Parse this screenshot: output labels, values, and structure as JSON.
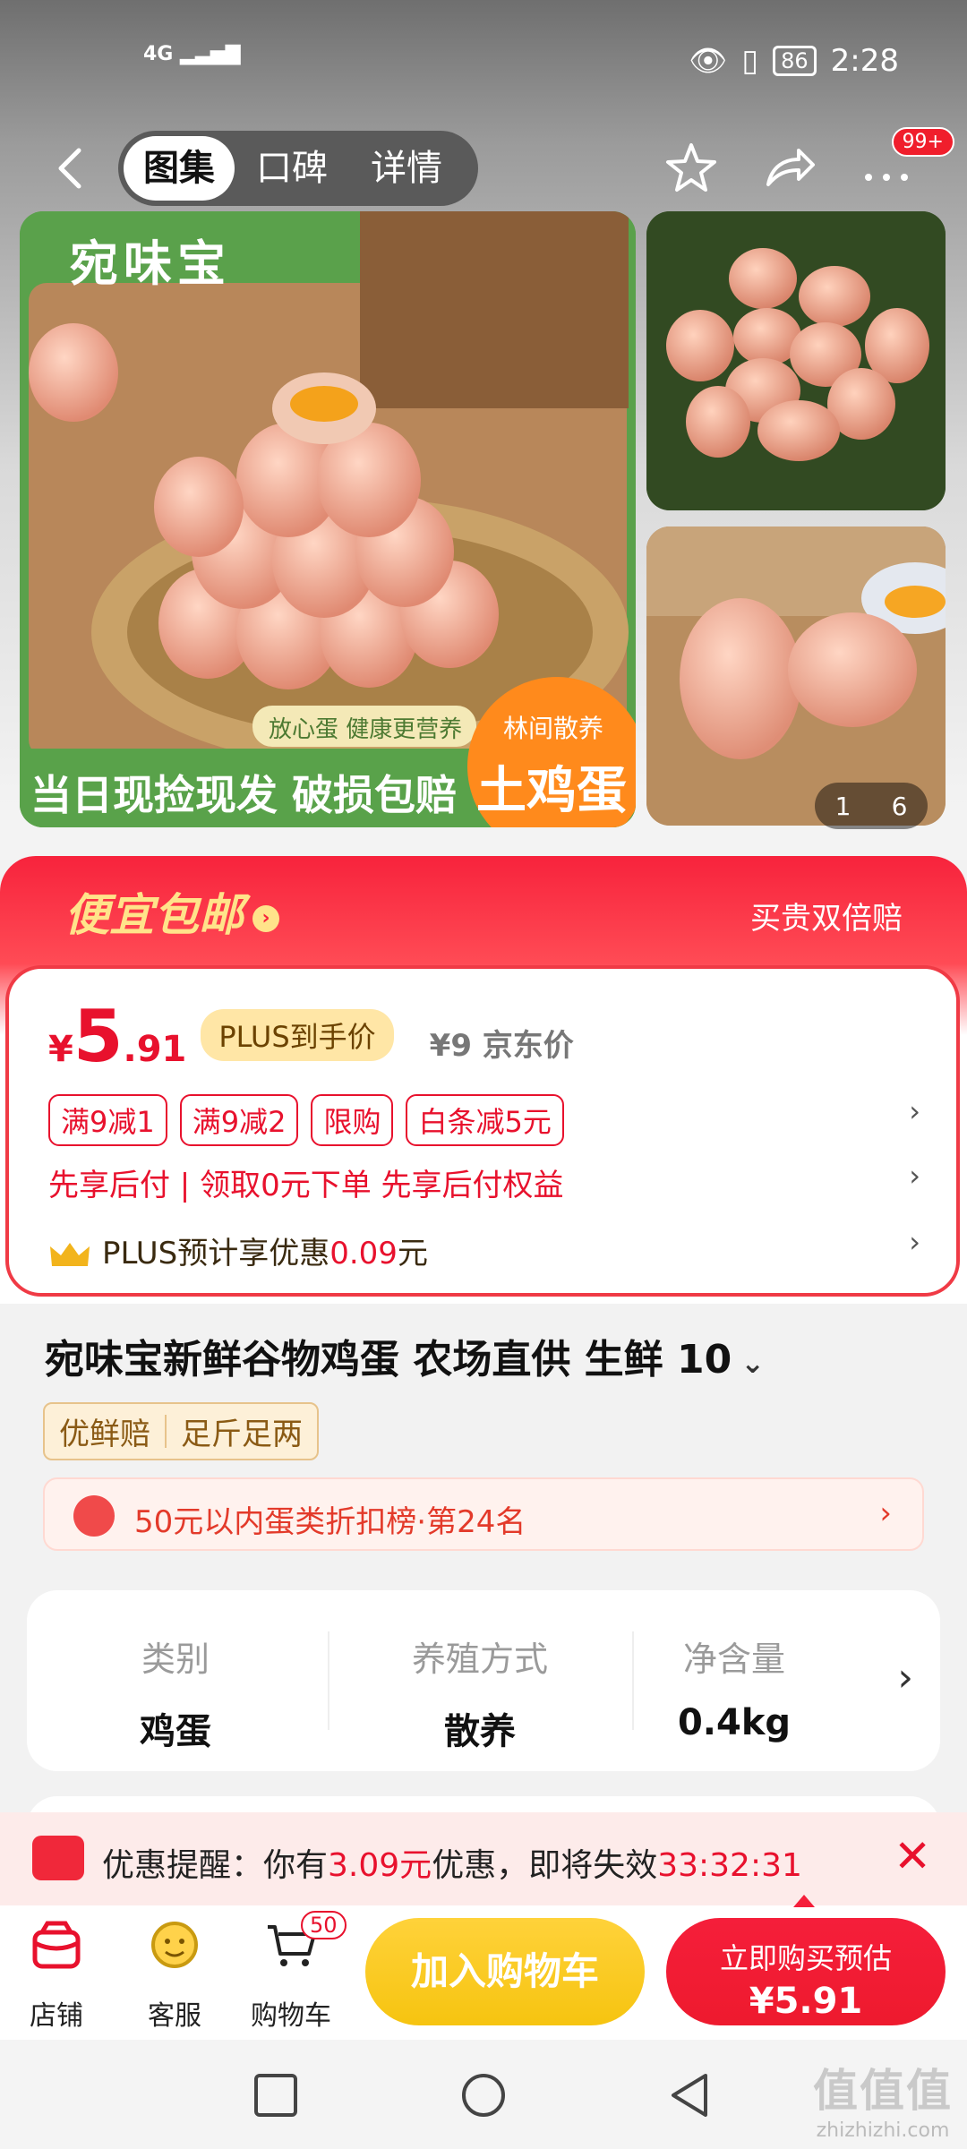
{
  "status_bar": {
    "network": "4G",
    "battery": "86",
    "time": "2:28"
  },
  "nav": {
    "tabs": [
      "图集",
      "口碑",
      "详情"
    ],
    "more_badge": "99+"
  },
  "gallery": {
    "main_brand": "宛味宝",
    "main_tagline_small": "放心蛋 健康更营养",
    "main_tagline": "当日现捡现发 破损包赔",
    "badge_top": "林间散养",
    "badge_main": "土鸡蛋",
    "counter_current": "1",
    "counter_total": "6"
  },
  "promo": {
    "title": "便宜包邮",
    "right": "买贵双倍赔",
    "price_int": "5",
    "price_dec": ".91",
    "currency": "¥",
    "plus_tag": "PLUS到手价",
    "jd_price": "¥9  京东价",
    "coupons": [
      "满9减1",
      "满9减2",
      "限购",
      "白条减5元"
    ],
    "pay_later": "先享后付 | 领取0元下单 先享后付权益",
    "plus_line_prefix": "PLUS预计享优惠",
    "plus_line_value": "0.09",
    "plus_line_suffix": "元"
  },
  "product": {
    "title": "宛味宝新鲜谷物鸡蛋 农场直供 生鲜 10",
    "tags": [
      "优鲜赔",
      "足斤足两"
    ],
    "rank": "50元以内蛋类折扣榜·第24名"
  },
  "specs": [
    {
      "key": "类别",
      "value": "鸡蛋"
    },
    {
      "key": "养殖方式",
      "value": "散养"
    },
    {
      "key": "净含量",
      "value": "0.4kg"
    }
  ],
  "reminder": {
    "prefix": "优惠提醒：你有",
    "amount": "3.09元",
    "middle": "优惠，即将失效",
    "countdown": "33:32:31"
  },
  "bottom_bar": {
    "store": "店铺",
    "service": "客服",
    "cart": "购物车",
    "cart_count": "50",
    "add_to_cart": "加入购物车",
    "buy_line1": "立即购买预估",
    "buy_line2": "¥5.91"
  },
  "watermark": {
    "big": "值值值",
    "small": "zhizhizhi.com"
  },
  "colors": {
    "accent_red": "#e8112d",
    "cart_yellow": "#f6c410",
    "plus_gold": "#ffe6a6"
  }
}
